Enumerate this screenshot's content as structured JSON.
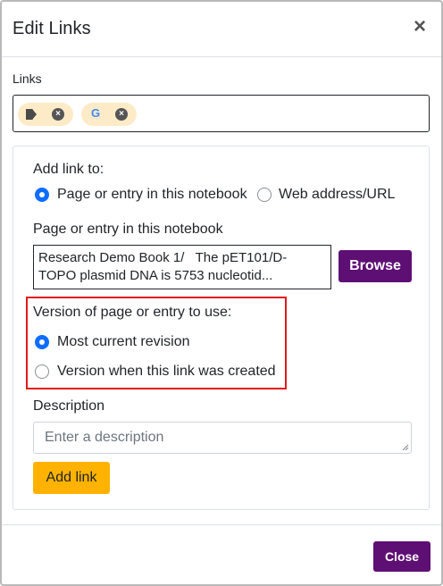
{
  "dialog": {
    "title": "Edit Links",
    "close_glyph": "×"
  },
  "links": {
    "label": "Links",
    "chips": [
      {
        "icon": "page-arrow-icon",
        "remove_glyph": "×"
      },
      {
        "icon": "google-icon",
        "icon_text": "G",
        "remove_glyph": "×"
      }
    ]
  },
  "form": {
    "add_link_to_label": "Add link to:",
    "link_type_options": [
      {
        "label": "Page or entry in this notebook",
        "checked": true
      },
      {
        "label": "Web address/URL",
        "checked": false
      }
    ],
    "entry_label": "Page or entry in this notebook",
    "entry_value": "Research Demo Book 1/   The pET101/D-\nTOPO plasmid DNA is 5753 nucleotid...",
    "browse_label": "Browse",
    "version_label": "Version of page or entry to use:",
    "version_options": [
      {
        "label": "Most current revision",
        "checked": true
      },
      {
        "label": "Version when this link was created",
        "checked": false
      }
    ],
    "description_label": "Description",
    "description_placeholder": "Enter a description",
    "description_value": "",
    "add_link_label": "Add link"
  },
  "footer": {
    "close_label": "Close"
  },
  "colors": {
    "primary_purple": "#5e0f74",
    "accent_yellow": "#ffb300",
    "radio_blue": "#0d6efd",
    "highlight_red": "#e21a1a",
    "chip_bg": "#fdebc8"
  }
}
